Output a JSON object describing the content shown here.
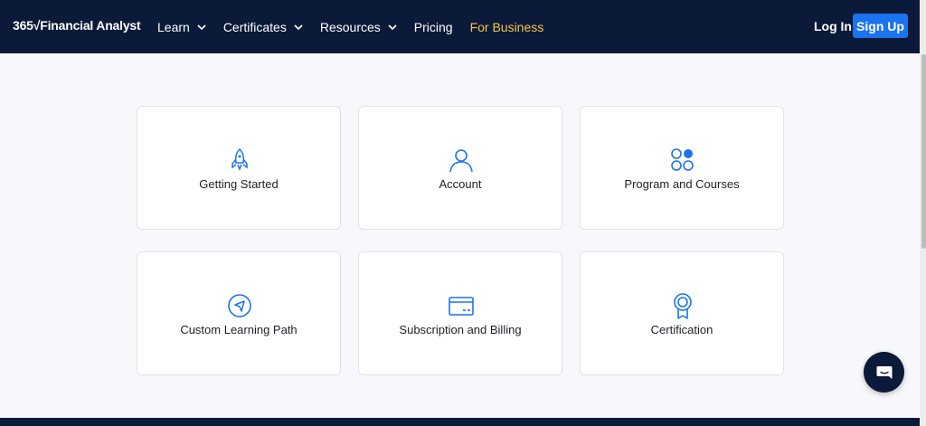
{
  "header": {
    "logo_text": "365√Financial Analyst",
    "nav": [
      {
        "label": "Learn"
      },
      {
        "label": "Certificates"
      },
      {
        "label": "Resources"
      },
      {
        "label": "Pricing"
      },
      {
        "label": "For Business"
      }
    ],
    "login_label": "Log In",
    "signup_label": "Sign Up"
  },
  "cards": [
    {
      "label": "Getting Started",
      "icon": "rocket-icon"
    },
    {
      "label": "Account",
      "icon": "user-icon"
    },
    {
      "label": "Program and Courses",
      "icon": "grid-circles-icon"
    },
    {
      "label": "Custom Learning Path",
      "icon": "compass-icon"
    },
    {
      "label": "Subscription and Billing",
      "icon": "credit-card-icon"
    },
    {
      "label": "Certification",
      "icon": "award-icon"
    }
  ],
  "colors": {
    "header_bg": "#0b1a38",
    "accent": "#1b73f0",
    "business": "#f3c64a",
    "page_bg": "#f7f8fb"
  },
  "chat": {
    "icon": "chat-bubble-icon"
  }
}
